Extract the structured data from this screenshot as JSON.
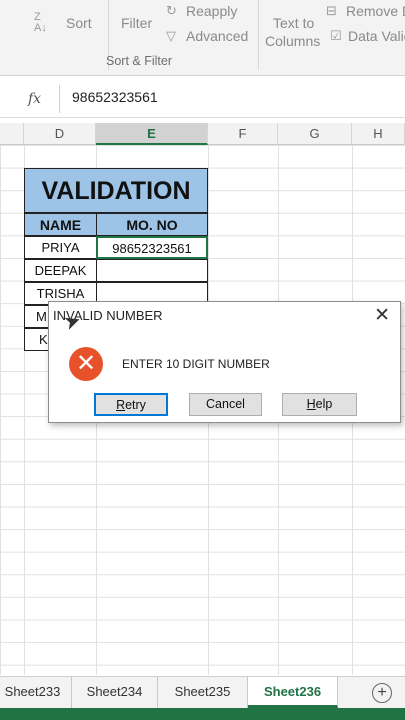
{
  "ribbon": {
    "sort_label": "Sort",
    "sort_az_icon": "A↓Z",
    "filter_label": "Filter",
    "reapply_label": "Reapply",
    "advanced_label": "Advanced",
    "text_to_label": "Text to",
    "columns_label": "Columns",
    "remove_label": "Remove D",
    "data_valid_label": "Data Valid",
    "group_label": "Sort & Filter"
  },
  "formula_bar": {
    "fx": "fx",
    "value": "98652323561"
  },
  "columns": [
    "D",
    "E",
    "F",
    "G",
    "H"
  ],
  "active_column": "E",
  "table": {
    "title": "VALIDATION",
    "headers": [
      "NAME",
      "MO. NO"
    ],
    "rows": [
      {
        "name": "PRIYA",
        "mobile": "98652323561"
      },
      {
        "name": "DEEPAK",
        "mobile": ""
      },
      {
        "name": "TRISHA",
        "mobile": ""
      },
      {
        "name": "M",
        "mobile": ""
      },
      {
        "name": "K",
        "mobile": ""
      }
    ]
  },
  "dialog": {
    "title": "INVALID NUMBER",
    "message": "ENTER 10 DIGIT NUMBER",
    "retry": "Retry",
    "cancel": "Cancel",
    "help": "Help",
    "close": "✕"
  },
  "sheet_tabs": [
    "Sheet233",
    "Sheet234",
    "Sheet235",
    "Sheet236"
  ],
  "active_sheet": "Sheet236",
  "colors": {
    "accent": "#217346",
    "header_fill": "#9dc3e6",
    "error": "#e8522a"
  }
}
